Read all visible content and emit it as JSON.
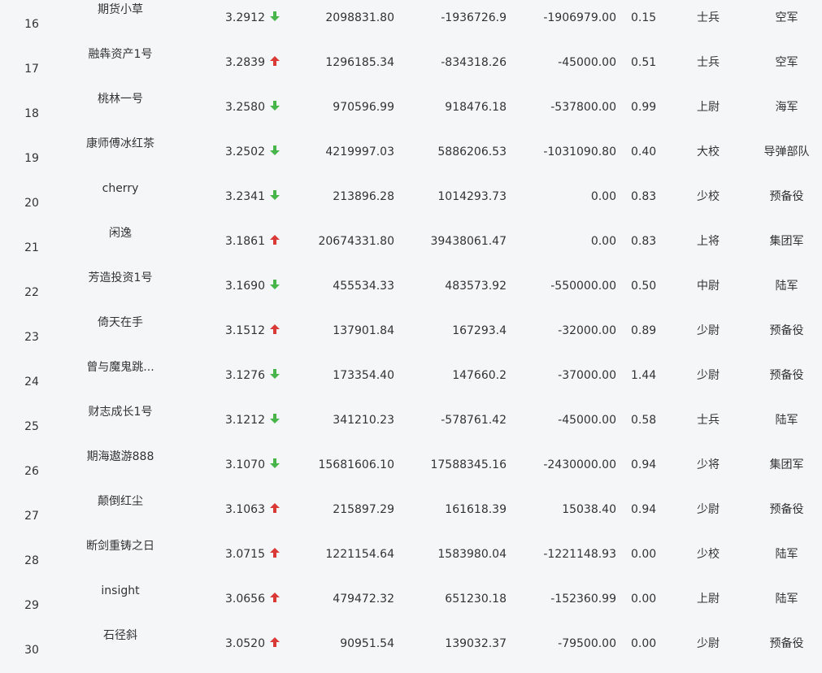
{
  "colors": {
    "background": "#f5f6f8",
    "text": "#333333",
    "up": "#d93a35",
    "down": "#48b54a"
  },
  "rows": [
    {
      "rank": "16",
      "name": "期货小草",
      "score": "3.2912",
      "trend": "down",
      "v1": "2098831.80",
      "v2": "-1936726.9",
      "v3": "-1906979.00",
      "ratio": "0.15",
      "rank_name": "士兵",
      "branch": "空军"
    },
    {
      "rank": "17",
      "name": "融犇资产1号",
      "score": "3.2839",
      "trend": "up",
      "v1": "1296185.34",
      "v2": "-834318.26",
      "v3": "-45000.00",
      "ratio": "0.51",
      "rank_name": "士兵",
      "branch": "空军"
    },
    {
      "rank": "18",
      "name": "桃林一号",
      "score": "3.2580",
      "trend": "down",
      "v1": "970596.99",
      "v2": "918476.18",
      "v3": "-537800.00",
      "ratio": "0.99",
      "rank_name": "上尉",
      "branch": "海军"
    },
    {
      "rank": "19",
      "name": "康师傅冰红茶",
      "score": "3.2502",
      "trend": "down",
      "v1": "4219997.03",
      "v2": "5886206.53",
      "v3": "-1031090.80",
      "ratio": "0.40",
      "rank_name": "大校",
      "branch": "导弹部队"
    },
    {
      "rank": "20",
      "name": "cherry",
      "score": "3.2341",
      "trend": "down",
      "v1": "213896.28",
      "v2": "1014293.73",
      "v3": "0.00",
      "ratio": "0.83",
      "rank_name": "少校",
      "branch": "预备役"
    },
    {
      "rank": "21",
      "name": "闲逸",
      "score": "3.1861",
      "trend": "up",
      "v1": "20674331.80",
      "v2": "39438061.47",
      "v3": "0.00",
      "ratio": "0.83",
      "rank_name": "上将",
      "branch": "集团军"
    },
    {
      "rank": "22",
      "name": "芳造投资1号",
      "score": "3.1690",
      "trend": "down",
      "v1": "455534.33",
      "v2": "483573.92",
      "v3": "-550000.00",
      "ratio": "0.50",
      "rank_name": "中尉",
      "branch": "陆军"
    },
    {
      "rank": "23",
      "name": "倚天在手",
      "score": "3.1512",
      "trend": "up",
      "v1": "137901.84",
      "v2": "167293.4",
      "v3": "-32000.00",
      "ratio": "0.89",
      "rank_name": "少尉",
      "branch": "预备役"
    },
    {
      "rank": "24",
      "name": "曾与魔鬼跳...",
      "score": "3.1276",
      "trend": "down",
      "v1": "173354.40",
      "v2": "147660.2",
      "v3": "-37000.00",
      "ratio": "1.44",
      "rank_name": "少尉",
      "branch": "预备役"
    },
    {
      "rank": "25",
      "name": "财志成长1号",
      "score": "3.1212",
      "trend": "down",
      "v1": "341210.23",
      "v2": "-578761.42",
      "v3": "-45000.00",
      "ratio": "0.58",
      "rank_name": "士兵",
      "branch": "陆军"
    },
    {
      "rank": "26",
      "name": "期海遨游888",
      "score": "3.1070",
      "trend": "down",
      "v1": "15681606.10",
      "v2": "17588345.16",
      "v3": "-2430000.00",
      "ratio": "0.94",
      "rank_name": "少将",
      "branch": "集团军"
    },
    {
      "rank": "27",
      "name": "颠倒红尘",
      "score": "3.1063",
      "trend": "up",
      "v1": "215897.29",
      "v2": "161618.39",
      "v3": "15038.40",
      "ratio": "0.94",
      "rank_name": "少尉",
      "branch": "预备役"
    },
    {
      "rank": "28",
      "name": "断剑重铸之日",
      "score": "3.0715",
      "trend": "up",
      "v1": "1221154.64",
      "v2": "1583980.04",
      "v3": "-1221148.93",
      "ratio": "0.00",
      "rank_name": "少校",
      "branch": "陆军"
    },
    {
      "rank": "29",
      "name": "insight",
      "score": "3.0656",
      "trend": "up",
      "v1": "479472.32",
      "v2": "651230.18",
      "v3": "-152360.99",
      "ratio": "0.00",
      "rank_name": "上尉",
      "branch": "陆军"
    },
    {
      "rank": "30",
      "name": "石径斜",
      "score": "3.0520",
      "trend": "up",
      "v1": "90951.54",
      "v2": "139032.37",
      "v3": "-79500.00",
      "ratio": "0.00",
      "rank_name": "少尉",
      "branch": "预备役"
    }
  ]
}
